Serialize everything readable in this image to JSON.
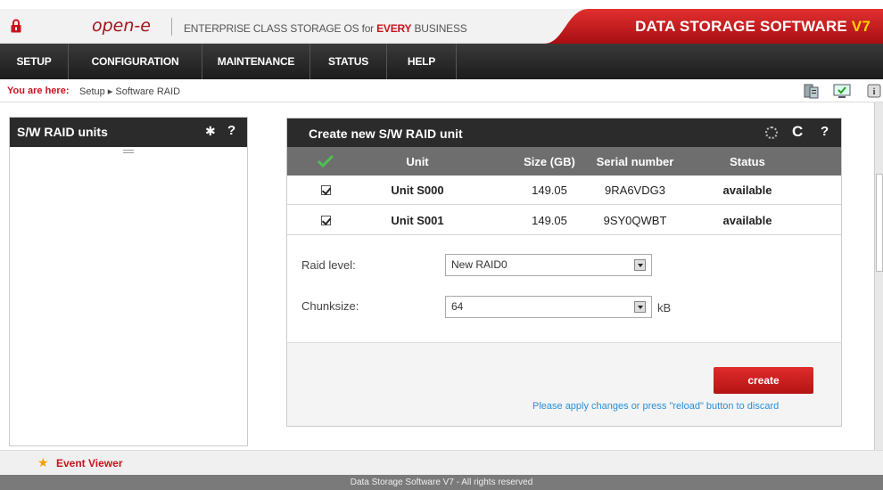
{
  "header": {
    "logo": "open-e",
    "tagline_prefix": "ENTERPRISE CLASS STORAGE OS for ",
    "tagline_highlight": "EVERY",
    "tagline_suffix": " BUSINESS",
    "brand": "DATA STORAGE SOFTWARE ",
    "brand_version": "V7"
  },
  "nav": [
    "SETUP",
    "CONFIGURATION",
    "MAINTENANCE",
    "STATUS",
    "HELP"
  ],
  "breadcrumb": {
    "prefix": "You are here:",
    "path": "Setup ▸ Software RAID"
  },
  "left_panel": {
    "title": "S/W RAID units",
    "gear": "✱",
    "help": "?"
  },
  "main_panel": {
    "title": "Create new S/W RAID unit",
    "reload": "C",
    "help": "?",
    "columns": [
      "",
      "Unit",
      "Size (GB)",
      "Serial number",
      "Status"
    ],
    "rows": [
      {
        "unit": "Unit S000",
        "size": "149.05",
        "serial": "9RA6VDG3",
        "status": "available",
        "checked": true
      },
      {
        "unit": "Unit S001",
        "size": "149.05",
        "serial": "9SY0QWBT",
        "status": "available",
        "checked": true
      }
    ],
    "raid_level_label": "Raid level:",
    "raid_level_value": "New RAID0",
    "chunksize_label": "Chunksize:",
    "chunksize_value": "64",
    "chunksize_unit": "kB",
    "create_label": "create",
    "hint": "Please apply changes or press \"reload\" button to discard"
  },
  "event_viewer": "Event Viewer",
  "footer": "Data Storage Software V7 - All rights reserved",
  "colors": {
    "brand_red": "#c8141c",
    "dark": "#2b2b2b",
    "table_header": "#6e6e6e",
    "hint_blue": "#2a8fd6",
    "version_yellow": "#ffd400"
  }
}
